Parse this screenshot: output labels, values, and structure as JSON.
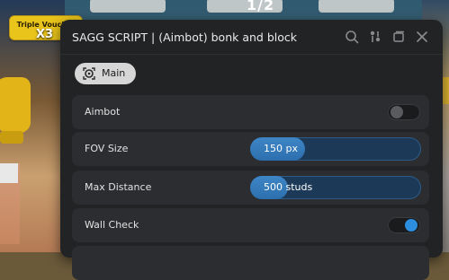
{
  "game": {
    "badge_title": "Triple Voucher",
    "badge_multiplier": "X3",
    "counter": "1/2"
  },
  "window": {
    "title": "SAGG SCRIPT | (Aimbot) bonk and block",
    "icons": [
      "search-icon",
      "settings-icon",
      "minimize-icon",
      "close-icon"
    ]
  },
  "tabs": [
    {
      "label": "Main",
      "icon": "target-icon",
      "active": true
    }
  ],
  "settings": {
    "aimbot": {
      "label": "Aimbot",
      "enabled": false
    },
    "fov": {
      "label": "FOV Size",
      "value_text": "150 px",
      "fill_fraction": 0.32
    },
    "max_distance": {
      "label": "Max Distance",
      "value_text": "500 studs",
      "fill_fraction": 0.22
    },
    "wall_check": {
      "label": "Wall Check",
      "enabled": true
    }
  },
  "colors": {
    "accent": "#2d8ee0",
    "window_bg": "#222325",
    "row_bg": "#2c2d30"
  }
}
